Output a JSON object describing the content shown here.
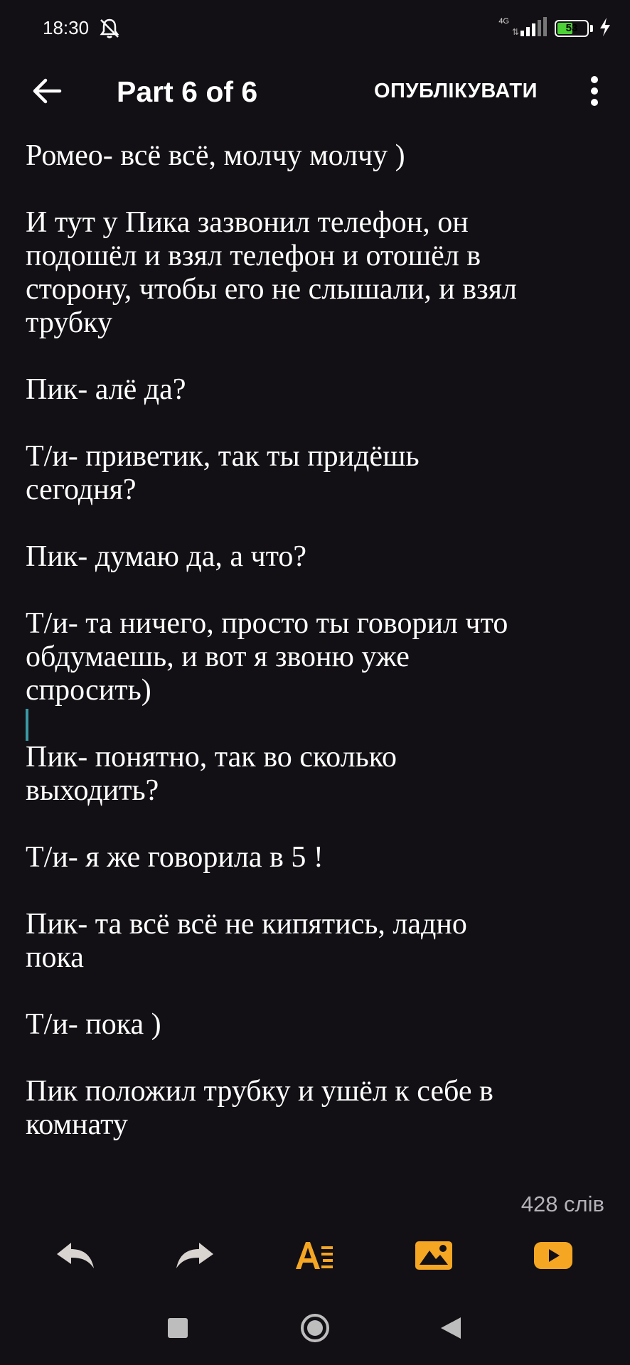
{
  "status_bar": {
    "time": "18:30",
    "network_type": "4G",
    "battery_level": "53",
    "battery_fraction": 0.53,
    "icons": [
      "alarm-off-icon",
      "signal-icon",
      "battery-icon",
      "charging-icon"
    ]
  },
  "app_bar": {
    "title": "Part 6 of 6",
    "publish_label": "ОПУБЛІКУВАТИ",
    "icons": [
      "back-arrow-icon",
      "more-vert-icon"
    ]
  },
  "editor": {
    "lines": [
      "Ромео- всё всё, молчу молчу )",
      "",
      "И тут у Пика зазвонил телефон, он",
      "подошёл и взял телефон и отошёл в",
      "сторону, чтобы его не слышали, и взял",
      "трубку",
      "",
      "Пик- алё да?",
      "",
      "Т/и- приветик, так ты придёшь",
      "сегодня?",
      "",
      "Пик- думаю да, а что?",
      "",
      "Т/и- та ничего, просто ты говорил что",
      "обдумаешь, и вот я звоню уже",
      "спросить)",
      "",
      "Пик- понятно, так во сколько",
      "выходить?",
      "",
      "Т/и- я же говорила в 5 !",
      "",
      "Пик- та всё всё не кипятись, ладно",
      "пока",
      "",
      "Т/и- пока )",
      "",
      "Пик положил трубку и ушёл к себе в",
      "комнату"
    ]
  },
  "word_count": "428 слів",
  "toolbar": {
    "accent_color": "#f5a623",
    "icons": [
      "undo-icon",
      "redo-icon",
      "text-format-icon",
      "insert-image-icon",
      "insert-video-icon"
    ]
  },
  "nav_bar": {
    "icons": [
      "recents-icon",
      "home-icon",
      "back-nav-icon"
    ]
  }
}
